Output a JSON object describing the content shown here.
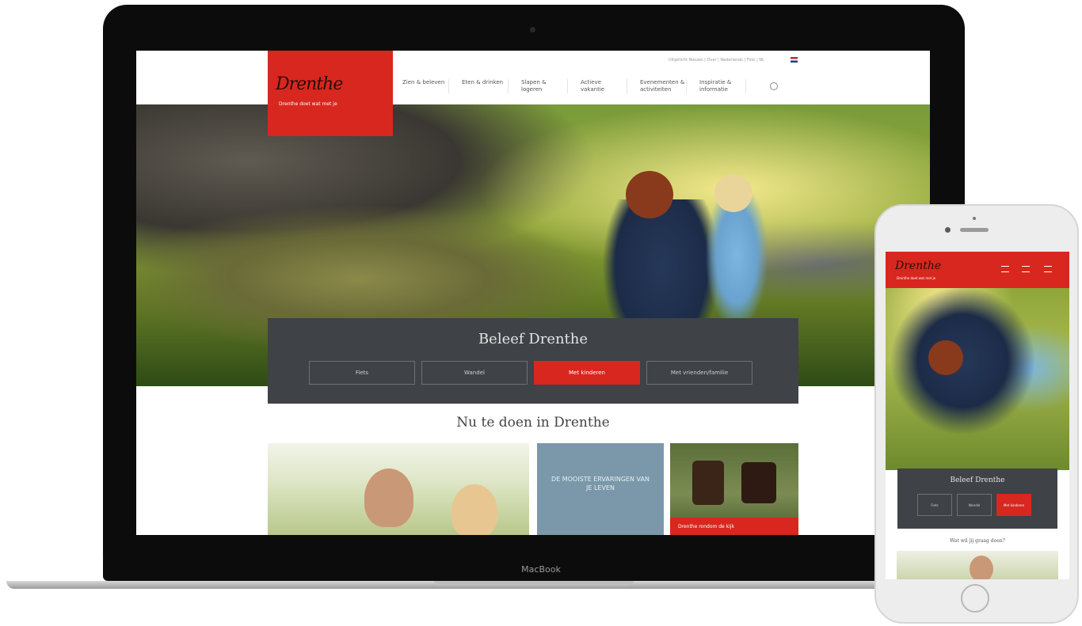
{
  "laptop": {
    "brand": "MacBook"
  },
  "site": {
    "utility_text": "Uitgelicht Nieuws | Over | Nederlands | Foto | NL",
    "logo": {
      "script": "Drenthe",
      "tagline": "Drenthe doet wat met je"
    },
    "nav": [
      "Zien & beleven",
      "Eten & drinken",
      "Slapen & logeren",
      "Actieve vakantie",
      "Evenementen & activiteiten",
      "Inspiratie & informatie"
    ],
    "hero": {
      "title": "Beleef Drenthe",
      "buttons": [
        "Fiets",
        "Wandel",
        "Met kinderen",
        "Met vrienden/familie"
      ],
      "active_index": 2
    },
    "section_title": "Nu te doen in Drenthe",
    "cards": [
      {
        "label": ""
      },
      {
        "label": "DE MOOISTE ERVARINGEN VAN JE LEVEN"
      },
      {
        "label": "Drenthe rondom de kijk"
      }
    ]
  },
  "phone": {
    "logo_script": "Drenthe",
    "tagline": "Drenthe doet wat met je",
    "hero_title": "Beleef Drenthe",
    "buttons": [
      "Fiets",
      "Wandel",
      "Met kinderen"
    ],
    "active_index": 2,
    "section_title": "Wat wil jij graag doen?"
  },
  "colors": {
    "brand_red": "#d8271f",
    "panel_dark": "#3f4246",
    "card_blue": "#7a98a9"
  }
}
